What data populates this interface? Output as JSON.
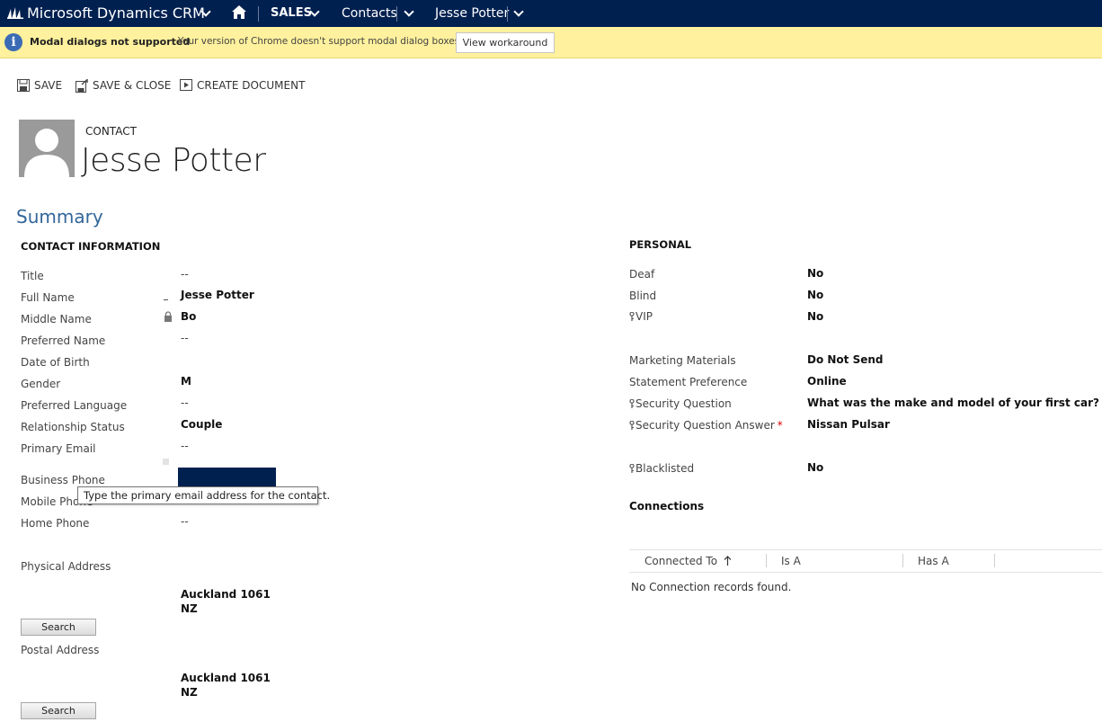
{
  "nav": {
    "app_title": "Microsoft Dynamics CRM",
    "area": "SALES",
    "entity": "Contacts",
    "record": "Jesse Potter"
  },
  "notification": {
    "title": "Modal dialogs not supported",
    "message": "Your version of Chrome doesn't support modal dialog boxes.",
    "button": "View workaround"
  },
  "commands": {
    "save": "SAVE",
    "save_close": "SAVE & CLOSE",
    "create_document": "CREATE DOCUMENT"
  },
  "header": {
    "entity_label": "CONTACT",
    "name": "Jesse Potter"
  },
  "section_title": "Summary",
  "contact_info": {
    "heading": "CONTACT INFORMATION",
    "title_label": "Title",
    "title_value": "--",
    "full_name_label": "Full Name",
    "full_name_value": "Jesse Potter",
    "middle_name_label": "Middle Name",
    "middle_name_value": "Bo",
    "preferred_name_label": "Preferred Name",
    "preferred_name_value": "--",
    "dob_label": "Date of Birth",
    "gender_label": "Gender",
    "gender_value": "M",
    "language_label": "Preferred Language",
    "language_value": "--",
    "relationship_label": "Relationship Status",
    "relationship_value": "Couple",
    "email_label": "Primary Email",
    "email_value": "--",
    "business_phone_label": "Business Phone",
    "mobile_phone_label": "Mobile Phone",
    "home_phone_label": "Home Phone",
    "home_phone_value": "--",
    "physical_address_label": "Physical Address",
    "physical_city": "Auckland 1061",
    "physical_country": "NZ",
    "search_label": "Search",
    "postal_address_label": "Postal Address",
    "postal_city": "Auckland 1061",
    "postal_country": "NZ",
    "tooltip": "Type the primary email address for the contact."
  },
  "personal": {
    "heading": "PERSONAL",
    "deaf_label": "Deaf",
    "deaf_value": "No",
    "blind_label": "Blind",
    "blind_value": "No",
    "vip_label": "VIP",
    "vip_value": "No",
    "marketing_label": "Marketing Materials",
    "marketing_value": "Do Not Send",
    "statement_label": "Statement Preference",
    "statement_value": "Online",
    "security_q_label": "Security Question",
    "security_q_value": "What was the make and model of your first car?",
    "security_a_label": "Security Question Answer",
    "security_a_value": "Nissan Pulsar",
    "required_mark": "*",
    "blacklisted_label": "Blacklisted",
    "blacklisted_value": "No"
  },
  "connections": {
    "heading": "Connections",
    "columns": [
      "Connected To",
      "Is A",
      "Has A"
    ],
    "empty": "No Connection records found."
  }
}
